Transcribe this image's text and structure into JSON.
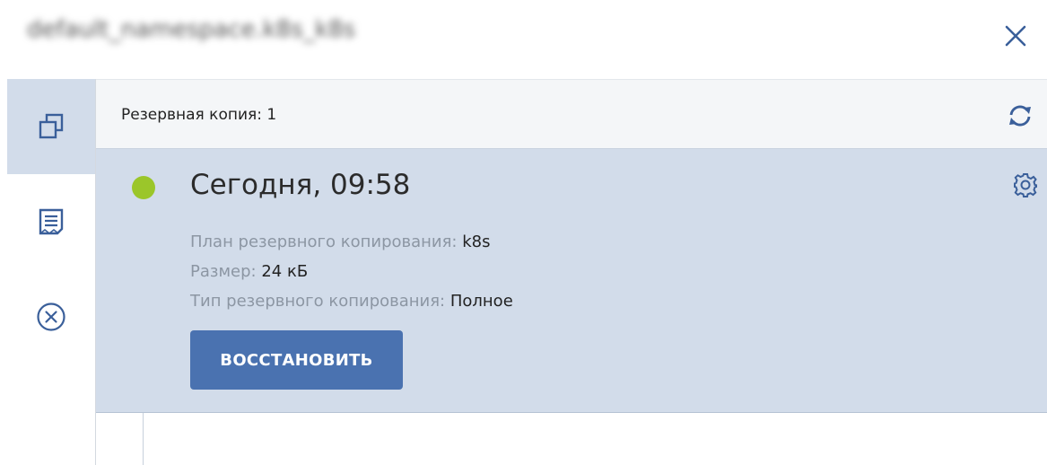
{
  "window": {
    "title": "default_namespace.k8s_k8s",
    "close_icon": "close-icon"
  },
  "sidebar": {
    "items": [
      {
        "icon": "copies-icon",
        "active": true
      },
      {
        "icon": "log-icon",
        "active": false
      },
      {
        "icon": "cancel-circle-icon",
        "active": false
      }
    ]
  },
  "header": {
    "count_label": "Резервная копия: 1",
    "refresh_icon": "refresh-icon"
  },
  "backup": {
    "status_color": "#9bc62a",
    "date": "Сегодня, 09:58",
    "plan_label": "План резервного копирования:",
    "plan_value": "k8s",
    "size_label": "Размер:",
    "size_value": "24 кБ",
    "type_label": "Тип резервного копирования:",
    "type_value": "Полное",
    "restore_label": "ВОССТАНОВИТЬ",
    "settings_icon": "gear-icon"
  },
  "colors": {
    "accent": "#4a72b0",
    "selected_bg": "#d2dcea",
    "status_ok": "#9bc62a"
  }
}
